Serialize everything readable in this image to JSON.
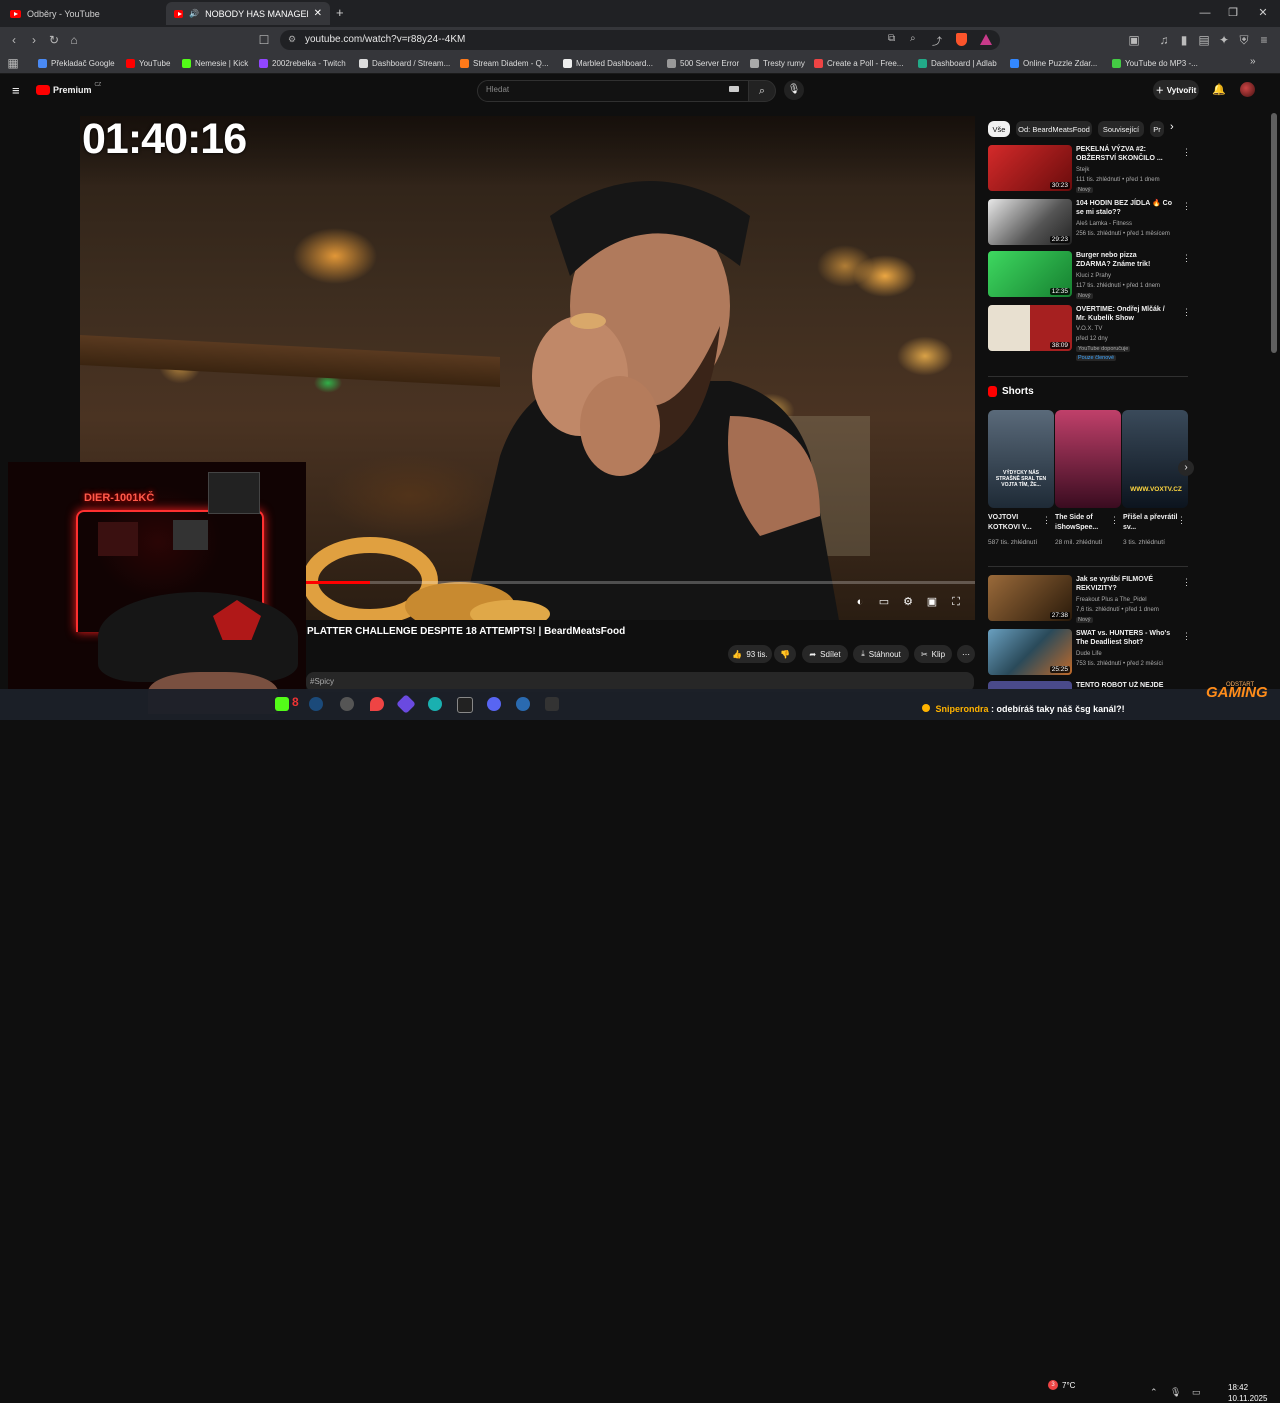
{
  "browser": {
    "tabs": [
      {
        "label": "Odběry - YouTube",
        "active": false
      },
      {
        "label": "NOBODY HAS MANAGED TO",
        "active": true
      }
    ],
    "new_tab": "+",
    "url": "youtube.com/watch?v=r88y24--4KM",
    "bookmarks": [
      "Překladač Google",
      "YouTube",
      "Nemesie | Kick",
      "2002rebelka - Twitch",
      "Dashboard / Stream...",
      "Stream Diadem - Q...",
      "Marbled Dashboard...",
      "500 Server Error",
      "Tresty rumy",
      "Create a Poll - Free...",
      "Dashboard | Adlab",
      "Online Puzzle Zdar...",
      "YouTube do MP3 -..."
    ]
  },
  "youtube": {
    "logo": "Premium",
    "logo_sup": "CZ",
    "search_placeholder": "Hledat",
    "create_label": "Vytvořit"
  },
  "player": {
    "timer_overlay": "01:40:16",
    "progress_fraction": 0.324
  },
  "webcam": {
    "sign": "DIER-1001KČ"
  },
  "video": {
    "title": "PLATTER CHALLENGE DESPITE 18 ATTEMPTS! | BeardMeatsFood",
    "likes": "93 tis.",
    "share": "Sdílet",
    "download": "Stáhnout",
    "clip": "Klip",
    "description_tag": "#Spicy"
  },
  "sidebar": {
    "chips": [
      "Vše",
      "Od: BeardMeatsFood",
      "Související",
      "Pr"
    ],
    "recommended": [
      {
        "title": "PEKELNÁ VÝZVA #2: OBŽERSTVÍ SKONČILO ...",
        "channel": "Stejk",
        "meta": "111 tis. zhlédnutí • před 1 dnem",
        "badge": "Nový",
        "duration": "30:23",
        "color": "#c0202a"
      },
      {
        "title": "104 HODIN BEZ JÍDLA 🔥 Co se mi stalo??",
        "channel": "Aleš Lamka - Fitness",
        "meta": "256 tis. zhlédnutí • před 1 měsícem",
        "badge": "",
        "duration": "29:23",
        "color": "#3a3a3a"
      },
      {
        "title": "Burger nebo pizza ZDARMA? Známe trik!",
        "channel": "Kluci z Prahy",
        "meta": "117 tis. zhlédnutí • před 1 dnem",
        "badge": "Nový",
        "duration": "12:35",
        "color": "#2fa84a"
      },
      {
        "title": "OVERTIME: Ondřej Mlčák / Mr. Kubelík Show",
        "channel": "V.O.X. TV",
        "meta": "před 12 dny",
        "badge": "YouTube doporučuje",
        "extra": "Pouze členové",
        "duration": "38:09",
        "color": "#7a1d1d"
      }
    ],
    "shorts_heading": "Shorts",
    "shorts": [
      {
        "title": "VOJTOVI KOTKOVI V...",
        "views": "587 tis. zhlédnutí",
        "caption": "VÝDYCKY NÁS STRAŠNĚ SRAL TEN VOJTA TÍM, ŽE...",
        "color": "#2e3a48"
      },
      {
        "title": "The Side of iShowSpee...",
        "views": "28 mil. zhlédnutí",
        "caption": "",
        "color": "#7a2040"
      },
      {
        "title": "Přišel a převrátil sv...",
        "views": "3 tis. zhlédnutí",
        "caption": "WWW.VOXTV.CZ",
        "color": "#1b2a3a"
      }
    ],
    "recommended2": [
      {
        "title": "Jak se vyrábí FILMOVÉ REKVIZITY?",
        "channel": "Freakout Plus a The_Pidel",
        "meta": "7,6 tis. zhlédnutí • před 1 dnem",
        "badge": "Nový",
        "duration": "27:38",
        "color": "#5a3a20"
      },
      {
        "title": "SWAT vs. HUNTERS - Who's The Deadliest Shot?",
        "channel": "Dude Life",
        "meta": "753 tis. zhlédnutí • před 2 měsíci",
        "badge": "",
        "duration": "25:25",
        "color": "#3a6a8a"
      },
      {
        "title": "TENTO ROBOT UŽ NEJDE",
        "channel": "",
        "meta": "",
        "badge": "",
        "duration": "",
        "color": "#4a4a7a"
      }
    ]
  },
  "taskbar": {
    "notification_user": "Sniperondra",
    "notification_text": " : odebíráš taky náš čsg kanál?!",
    "weather": "7°C",
    "time": "18:42",
    "date": "10.11.2025",
    "kick_count": "8",
    "overlay_brand": "GAMING",
    "overlay_brand_small": "ODSTART"
  }
}
